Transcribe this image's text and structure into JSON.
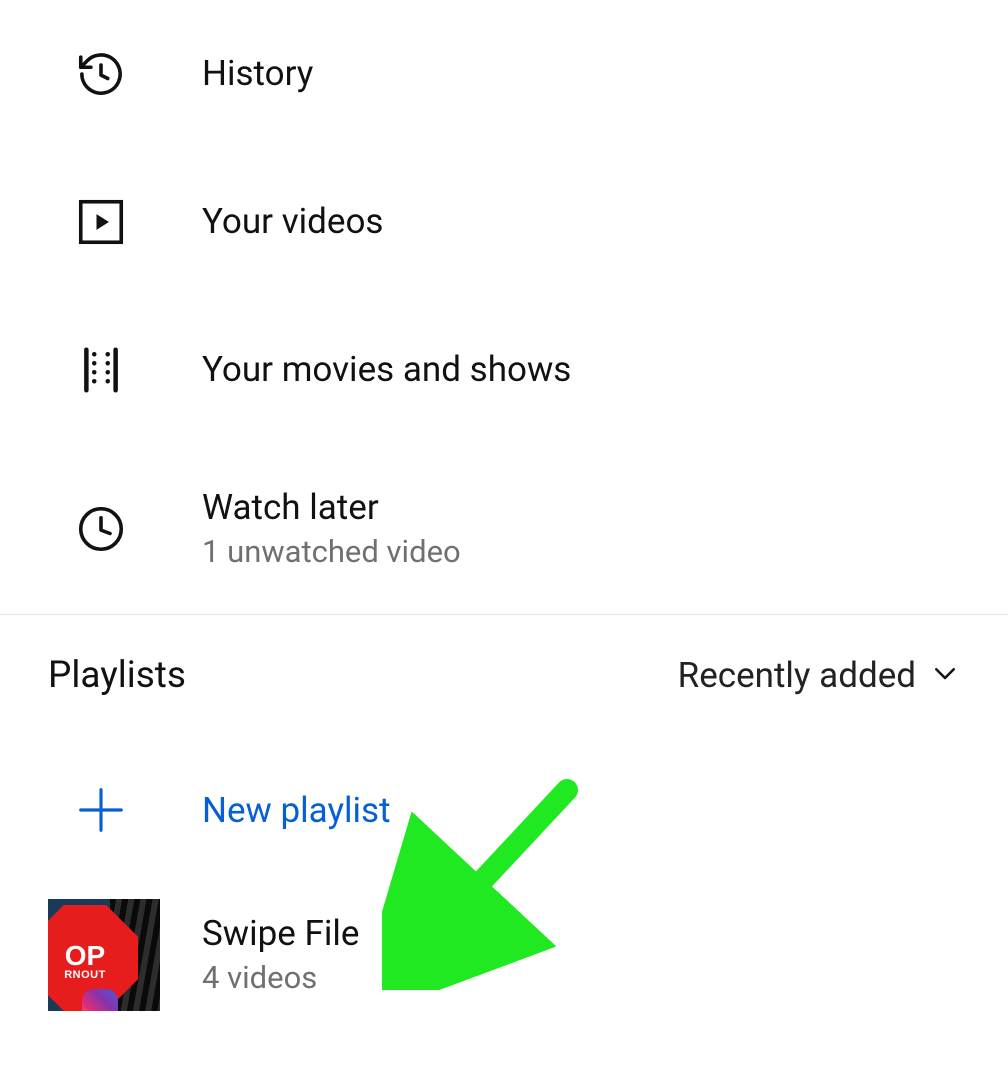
{
  "library": {
    "history_label": "History",
    "your_videos_label": "Your videos",
    "movies_shows_label": "Your movies and shows",
    "watch_later_label": "Watch later",
    "watch_later_sublabel": "1 unwatched video"
  },
  "playlists_section": {
    "title": "Playlists",
    "sort_label": "Recently added",
    "new_playlist_label": "New playlist"
  },
  "playlists": [
    {
      "title": "Swipe File",
      "count_label": "4 videos"
    }
  ],
  "colors": {
    "accent": "#065fd4",
    "text_secondary": "#707070",
    "annotation": "#21e921"
  }
}
